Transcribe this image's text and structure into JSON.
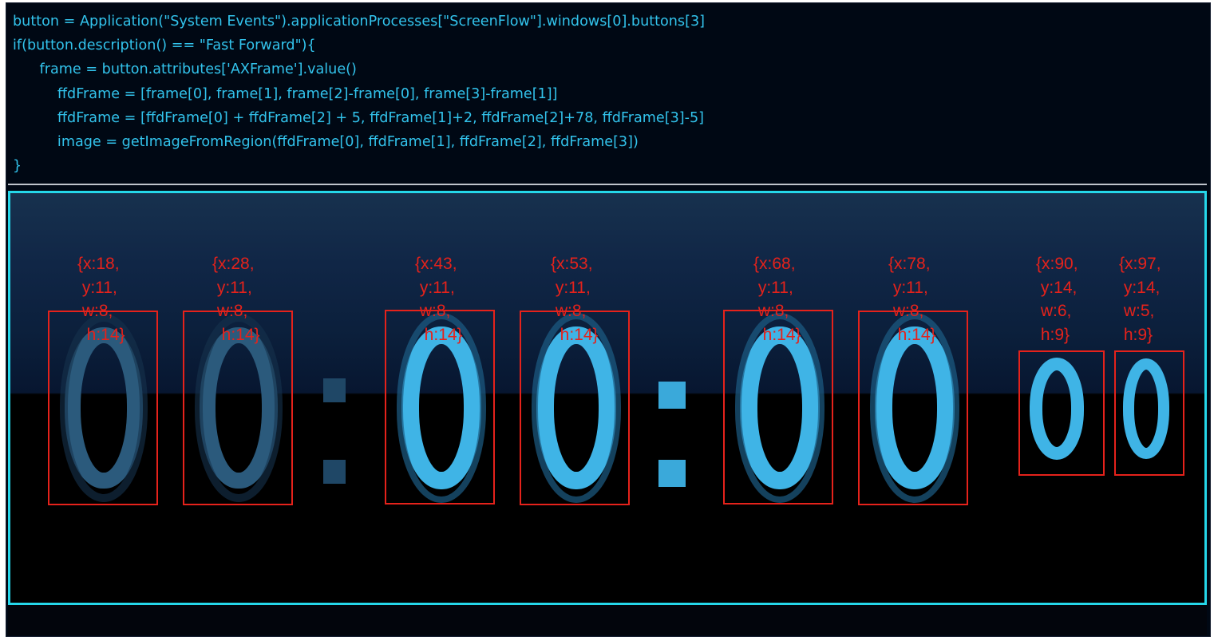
{
  "code": {
    "lines": [
      "button = Application(\"System Events\").applicationProcesses[\"ScreenFlow\"].windows[0].buttons[3]",
      "if(button.description() == \"Fast Forward\"){",
      "      frame = button.attributes['AXFrame'].value()",
      "          ffdFrame = [frame[0], frame[1], frame[2]-frame[0], frame[3]-frame[1]]",
      "          ffdFrame = [ffdFrame[0] + ffdFrame[2] + 5, ffdFrame[1]+2, ffdFrame[2]+78, ffdFrame[3]-5]",
      "          image = getImageFromRegion(ffdFrame[0], ffdFrame[1], ffdFrame[2], ffdFrame[3])",
      "}"
    ]
  },
  "capture": {
    "timecode": "00:00:00:00",
    "annotations": [
      {
        "lines": [
          "{x:18,",
          " y:11,",
          " w:8,",
          "  h:14}"
        ]
      },
      {
        "lines": [
          "{x:28,",
          " y:11,",
          " w:8,",
          "  h:14}"
        ]
      },
      {
        "lines": [
          "{x:43,",
          " y:11,",
          " w:8,",
          "  h:14}"
        ]
      },
      {
        "lines": [
          "{x:53,",
          " y:11,",
          " w:8,",
          "  h:14}"
        ]
      },
      {
        "lines": [
          "{x:68,",
          " y:11,",
          " w:8,",
          "  h:14}"
        ]
      },
      {
        "lines": [
          "{x:78,",
          " y:11,",
          " w:8,",
          "  h:14}"
        ]
      },
      {
        "lines": [
          "{x:90,",
          " y:14,",
          " w:6,",
          " h:9}"
        ]
      },
      {
        "lines": [
          "{x:97,",
          " y:14,",
          " w:5,",
          " h:9}"
        ]
      }
    ]
  },
  "colors": {
    "code_text": "#32c3ec",
    "annotation_red": "#e5221b",
    "capture_border": "#25d7ea",
    "digit_dim": "#2b5a7c",
    "digit_bright": "#3fb4e6"
  }
}
